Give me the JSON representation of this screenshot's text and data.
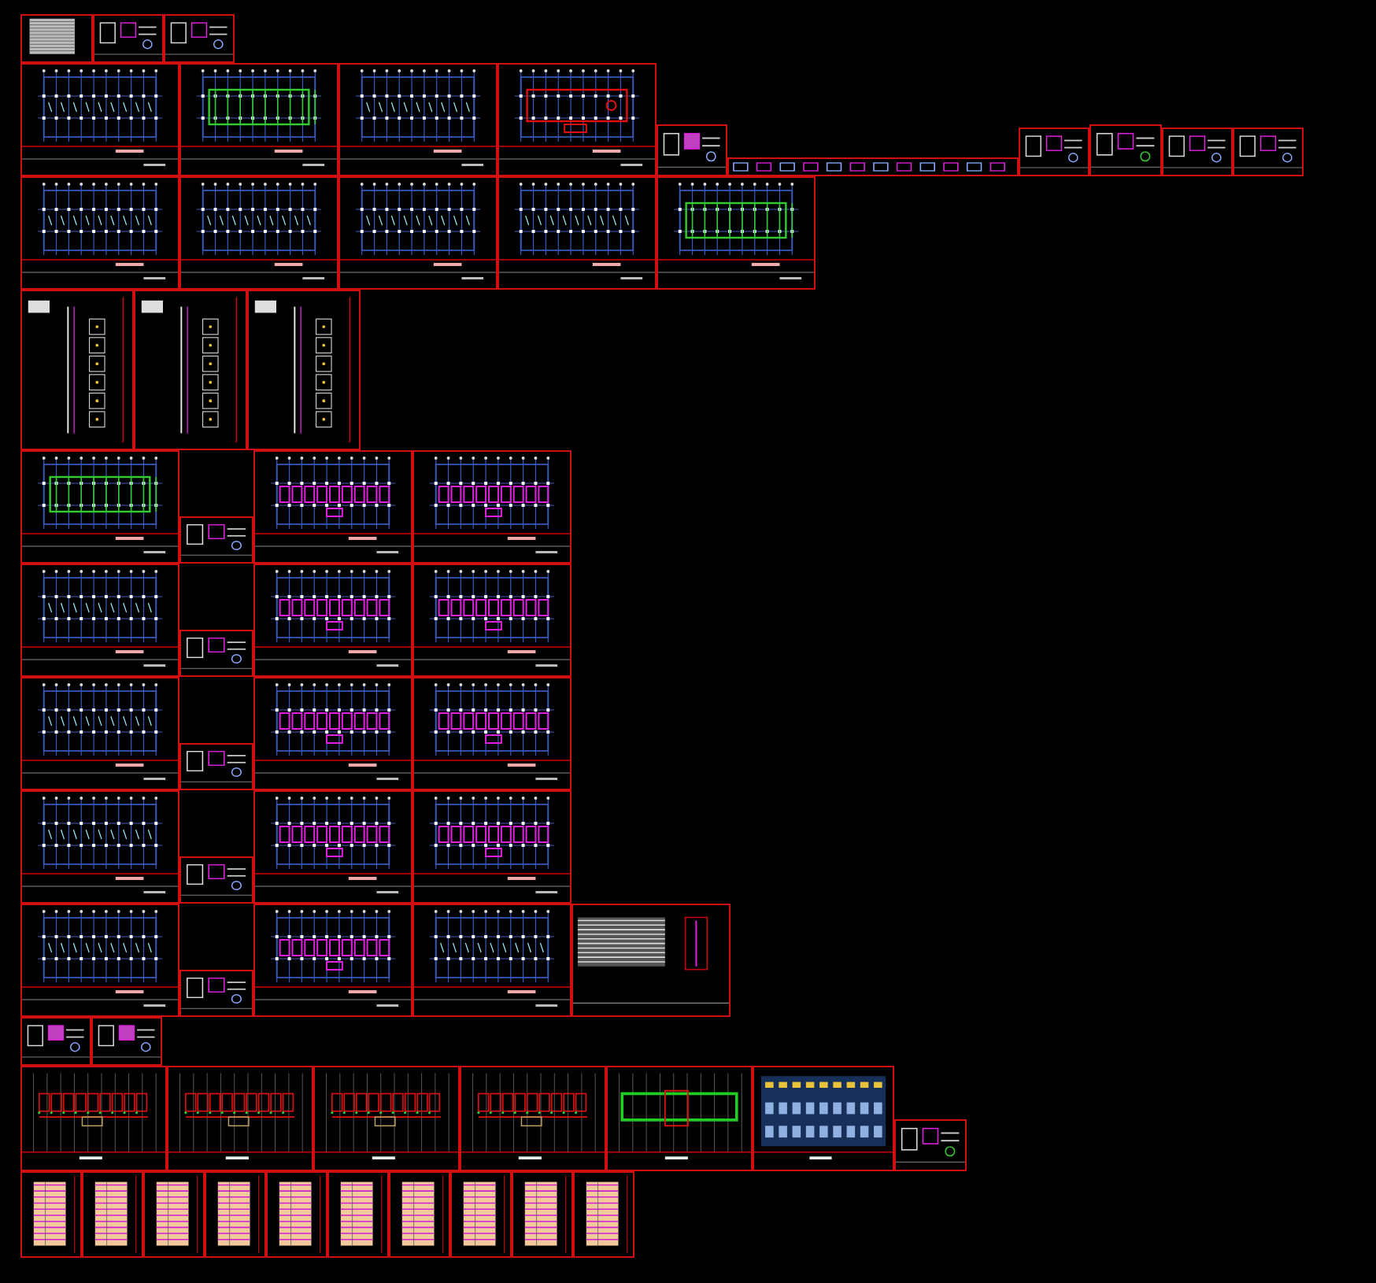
{
  "model_space": {
    "rows": [
      {
        "sheets": [
          {
            "kind": "table"
          },
          {
            "kind": "notes"
          },
          {
            "kind": "detail"
          }
        ]
      },
      {
        "sheets": [
          {
            "kind": "grid_plan"
          },
          {
            "kind": "beam_plan"
          },
          {
            "kind": "grid_plan"
          },
          {
            "kind": "foundation_plan"
          },
          {
            "kind": "site"
          },
          {
            "kind": "strip"
          },
          {
            "kind": "detail"
          },
          {
            "kind": "legend"
          },
          {
            "kind": "detail"
          },
          {
            "kind": "notes"
          }
        ]
      },
      {
        "sheets": [
          {
            "kind": "grid_plan"
          },
          {
            "kind": "grid_plan"
          },
          {
            "kind": "grid_plan"
          },
          {
            "kind": "grid_plan"
          },
          {
            "kind": "beam_plan"
          }
        ]
      },
      {
        "sheets": [
          {
            "kind": "section"
          },
          {
            "kind": "section"
          },
          {
            "kind": "section"
          }
        ]
      },
      {
        "sheets": [
          {
            "kind": "beam_plan"
          },
          {
            "kind": "detail_small"
          },
          {
            "kind": "slab_plan"
          },
          {
            "kind": "slab_plan"
          }
        ]
      },
      {
        "sheets": [
          {
            "kind": "grid_plan"
          },
          {
            "kind": "detail_small"
          },
          {
            "kind": "slab_plan"
          },
          {
            "kind": "slab_plan"
          }
        ]
      },
      {
        "sheets": [
          {
            "kind": "grid_plan"
          },
          {
            "kind": "detail_small"
          },
          {
            "kind": "slab_plan"
          },
          {
            "kind": "slab_plan"
          }
        ]
      },
      {
        "sheets": [
          {
            "kind": "grid_plan"
          },
          {
            "kind": "detail_small"
          },
          {
            "kind": "slab_plan"
          },
          {
            "kind": "slab_plan"
          }
        ]
      },
      {
        "sheets": [
          {
            "kind": "grid_plan"
          },
          {
            "kind": "detail_small"
          },
          {
            "kind": "slab_plan"
          },
          {
            "kind": "grid_plan"
          },
          {
            "kind": "schedule"
          }
        ]
      },
      {
        "sheets": [
          {
            "kind": "key_plan"
          },
          {
            "kind": "key_plan"
          }
        ]
      },
      {
        "sheets": [
          {
            "kind": "floor_plan"
          },
          {
            "kind": "floor_plan"
          },
          {
            "kind": "floor_plan"
          },
          {
            "kind": "floor_plan"
          },
          {
            "kind": "roof_plan"
          },
          {
            "kind": "elevation"
          },
          {
            "kind": "legend"
          }
        ]
      },
      {
        "sheets": [
          {
            "kind": "column_schedule"
          },
          {
            "kind": "column_schedule"
          },
          {
            "kind": "column_schedule"
          },
          {
            "kind": "column_schedule"
          },
          {
            "kind": "column_schedule"
          },
          {
            "kind": "column_schedule"
          },
          {
            "kind": "column_schedule"
          },
          {
            "kind": "column_schedule"
          },
          {
            "kind": "column_schedule"
          },
          {
            "kind": "column_schedule"
          }
        ]
      }
    ]
  }
}
